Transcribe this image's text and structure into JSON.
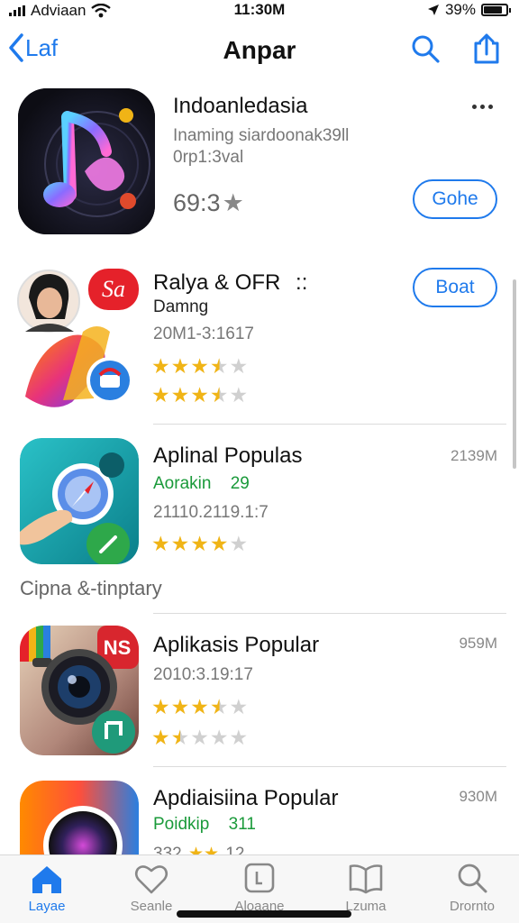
{
  "status_bar": {
    "carrier": "Adviaan",
    "time": "11:30M",
    "battery": "39%"
  },
  "nav": {
    "back_label": "Laf",
    "title": "Anpar"
  },
  "featured": {
    "title": "Indoanledasia",
    "subtitle_1": "Inaming siardoonak39ll",
    "subtitle_2": "0rp1:3val",
    "rating": "69:3",
    "button_label": "Gohe"
  },
  "apps": [
    {
      "title": "Ralya & OFR",
      "title_suffix": "::",
      "subtitle": "Damng",
      "date": "20M1-3:1617",
      "button_label": "Boat",
      "stars_row_1": 3.5,
      "stars_row_2": 3.5,
      "icon_badge": "Sa"
    },
    {
      "title": "Aplinal Populas",
      "subtitle": "Aorakin",
      "subtitle_extra": "29",
      "date": "21110.2119.1:7",
      "size": "2139M",
      "stars": 4
    },
    {
      "title": "Aplikasis Popular",
      "date": "2010:3.19:17",
      "size": "959M",
      "stars_row_1": 3.5,
      "stars_row_2": 1.5,
      "icon_badge": "NS"
    },
    {
      "title": "Apdiaisiina Popular",
      "subtitle": "Poidkip",
      "subtitle_extra": "311",
      "date": "332",
      "date_extra": "12",
      "size": "930M"
    }
  ],
  "section_header": "Cipna &-tinptary",
  "tabs": [
    {
      "label": "Layae",
      "icon": "home-icon",
      "active": true
    },
    {
      "label": "Seanle",
      "icon": "heart-icon",
      "active": false
    },
    {
      "label": "Aloaane",
      "icon": "square-icon",
      "active": false
    },
    {
      "label": "Lzuma",
      "icon": "book-icon",
      "active": false
    },
    {
      "label": "Drornto",
      "icon": "search-icon",
      "active": false
    }
  ],
  "colors": {
    "accent": "#1f7aec",
    "star": "#f0b416",
    "green": "#1a9a3a"
  }
}
